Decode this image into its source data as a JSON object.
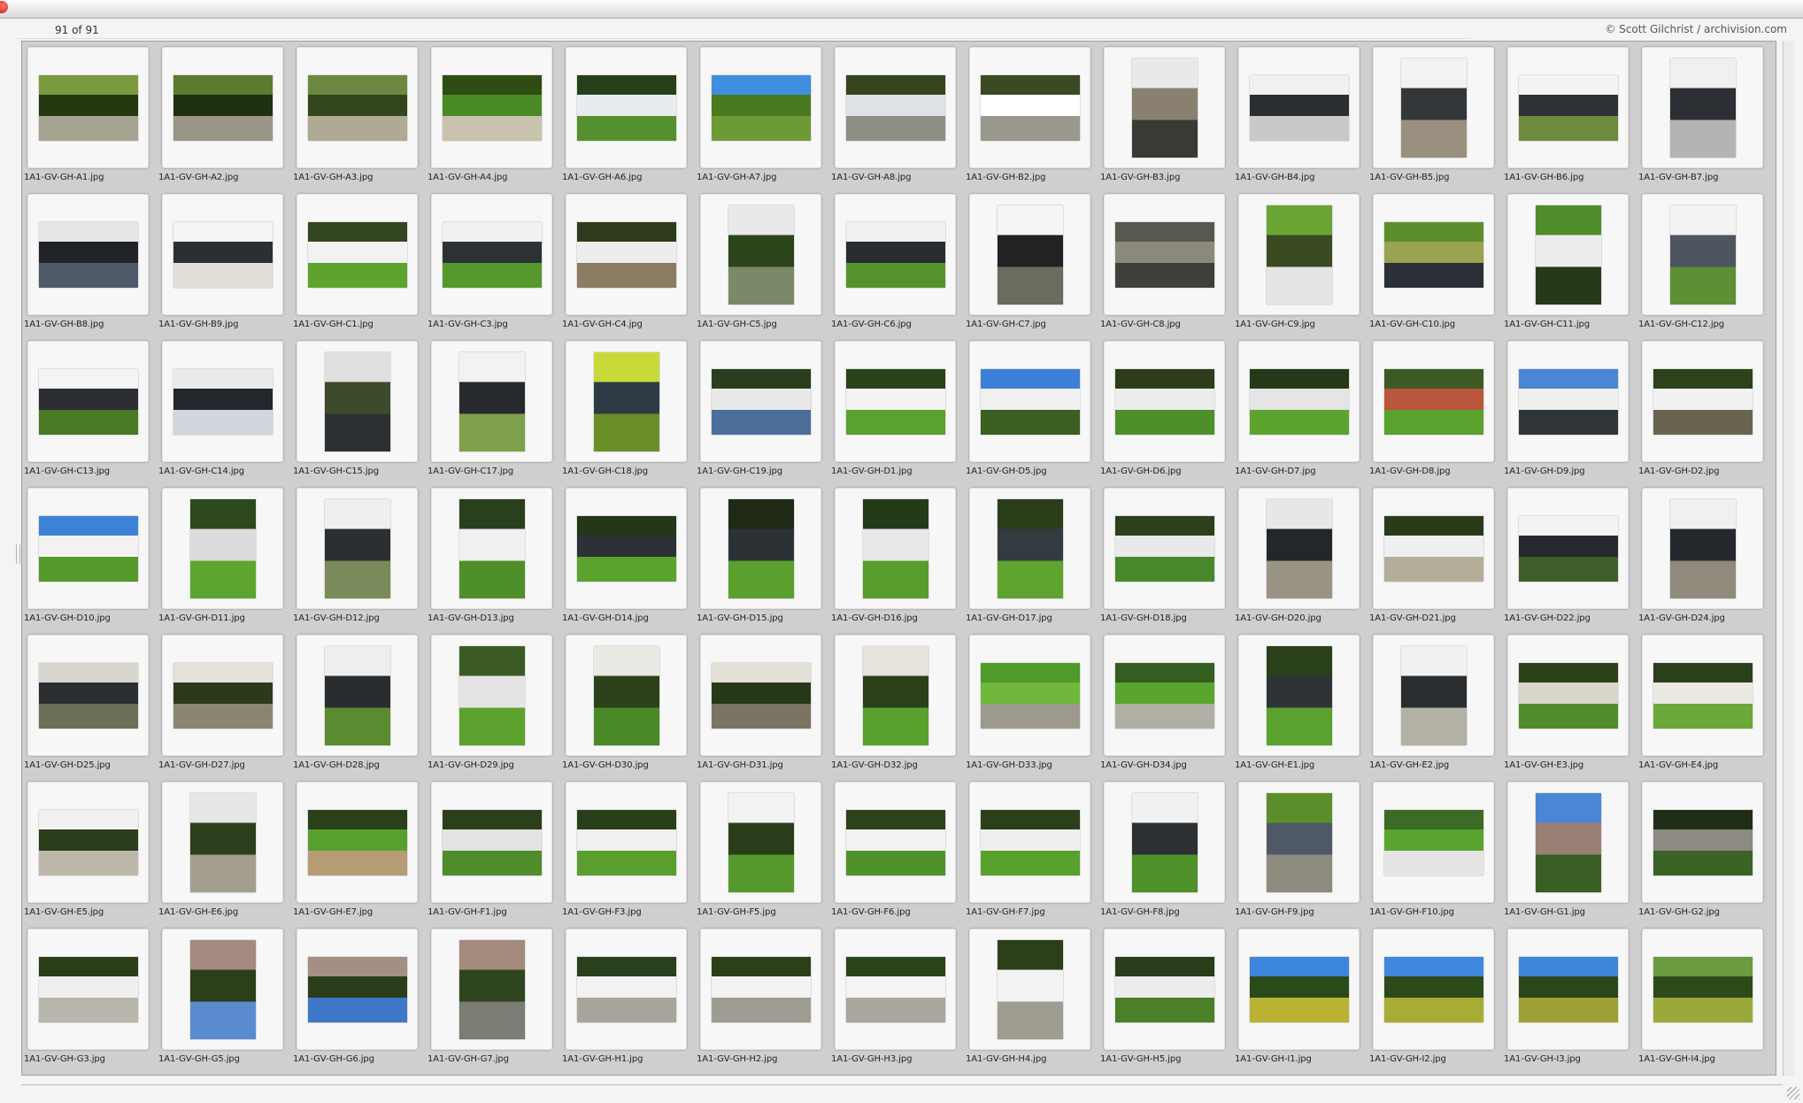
{
  "window": {
    "counter": "91 of 91",
    "credit": "© Scott Gilchrist / archivision.com"
  },
  "thumbnails": [
    {
      "name": "1A1-GV-GH-A1.jpg",
      "orientation": "landscape",
      "colors": [
        "#7a9a3e",
        "#24380f",
        "#a5a38f"
      ]
    },
    {
      "name": "1A1-GV-GH-A2.jpg",
      "orientation": "landscape",
      "colors": [
        "#5d7a2e",
        "#1f3010",
        "#9a9586"
      ]
    },
    {
      "name": "1A1-GV-GH-A3.jpg",
      "orientation": "landscape",
      "colors": [
        "#6b8740",
        "#33451b",
        "#b0a993"
      ]
    },
    {
      "name": "1A1-GV-GH-A4.jpg",
      "orientation": "landscape",
      "colors": [
        "#2f4d13",
        "#4a8a24",
        "#c9c2ad"
      ]
    },
    {
      "name": "1A1-GV-GH-A6.jpg",
      "orientation": "landscape",
      "colors": [
        "#27401b",
        "#e8ecee",
        "#55922f"
      ]
    },
    {
      "name": "1A1-GV-GH-A7.jpg",
      "orientation": "landscape",
      "colors": [
        "#3f8fe0",
        "#4a7a1f",
        "#6e9a35"
      ]
    },
    {
      "name": "1A1-GV-GH-A8.jpg",
      "orientation": "landscape",
      "colors": [
        "#35451f",
        "#dfe2e4",
        "#8f8e84"
      ]
    },
    {
      "name": "1A1-GV-GH-B2.jpg",
      "orientation": "landscape",
      "colors": [
        "#3a4a22",
        "#ffffff",
        "#9b988e"
      ]
    },
    {
      "name": "1A1-GV-GH-B3.jpg",
      "orientation": "portrait",
      "colors": [
        "#e9e9e9",
        "#8a8070",
        "#3a3a34"
      ]
    },
    {
      "name": "1A1-GV-GH-B4.jpg",
      "orientation": "landscape",
      "colors": [
        "#f0f0f0",
        "#2a2e33",
        "#c9c9c9"
      ]
    },
    {
      "name": "1A1-GV-GH-B5.jpg",
      "orientation": "portrait",
      "colors": [
        "#f2f2f2",
        "#33373a",
        "#9a9080"
      ]
    },
    {
      "name": "1A1-GV-GH-B6.jpg",
      "orientation": "landscape",
      "colors": [
        "#f3f3f3",
        "#2e3235",
        "#6c8b3c"
      ]
    },
    {
      "name": "1A1-GV-GH-B7.jpg",
      "orientation": "portrait",
      "colors": [
        "#f0f0f0",
        "#2c3034",
        "#b4b4b4"
      ]
    },
    {
      "name": "1A1-GV-GH-B8.jpg",
      "orientation": "landscape",
      "colors": [
        "#e6e6e6",
        "#202327",
        "#4d5a6a"
      ]
    },
    {
      "name": "1A1-GV-GH-B9.jpg",
      "orientation": "landscape",
      "colors": [
        "#f4f4f4",
        "#2b2f33",
        "#e0ded6"
      ]
    },
    {
      "name": "1A1-GV-GH-C1.jpg",
      "orientation": "landscape",
      "colors": [
        "#31461f",
        "#f2f2f2",
        "#5ea32c"
      ]
    },
    {
      "name": "1A1-GV-GH-C3.jpg",
      "orientation": "landscape",
      "colors": [
        "#f1f1f1",
        "#2d3236",
        "#55982b"
      ]
    },
    {
      "name": "1A1-GV-GH-C4.jpg",
      "orientation": "landscape",
      "colors": [
        "#2e3b1c",
        "#ededed",
        "#8b7c62"
      ]
    },
    {
      "name": "1A1-GV-GH-C5.jpg",
      "orientation": "portrait",
      "colors": [
        "#e9e9e9",
        "#2c4419",
        "#7a8a68"
      ]
    },
    {
      "name": "1A1-GV-GH-C6.jpg",
      "orientation": "landscape",
      "colors": [
        "#f0f0f0",
        "#2a2d30",
        "#56932c"
      ]
    },
    {
      "name": "1A1-GV-GH-C7.jpg",
      "orientation": "portrait",
      "colors": [
        "#f5f5f5",
        "#202224",
        "#6b6b5f"
      ]
    },
    {
      "name": "1A1-GV-GH-C8.jpg",
      "orientation": "landscape",
      "colors": [
        "#57584f",
        "#8b8a7a",
        "#3f403a"
      ]
    },
    {
      "name": "1A1-GV-GH-C9.jpg",
      "orientation": "portrait",
      "colors": [
        "#6aa533",
        "#3a4b22",
        "#e4e4e4"
      ]
    },
    {
      "name": "1A1-GV-GH-C10.jpg",
      "orientation": "landscape",
      "colors": [
        "#5c8f2b",
        "#9aa352",
        "#2a3035"
      ]
    },
    {
      "name": "1A1-GV-GH-C11.jpg",
      "orientation": "portrait",
      "colors": [
        "#4f8d2a",
        "#ececec",
        "#263a18"
      ]
    },
    {
      "name": "1A1-GV-GH-C12.jpg",
      "orientation": "portrait",
      "colors": [
        "#f3f3f3",
        "#4c5560",
        "#5f8f34"
      ]
    },
    {
      "name": "1A1-GV-GH-C13.jpg",
      "orientation": "landscape",
      "colors": [
        "#f4f4f4",
        "#2b2f33",
        "#4b7a26"
      ]
    },
    {
      "name": "1A1-GV-GH-C14.jpg",
      "orientation": "landscape",
      "colors": [
        "#eaeaea",
        "#23272b",
        "#cfd6dc"
      ]
    },
    {
      "name": "1A1-GV-GH-C15.jpg",
      "orientation": "portrait",
      "colors": [
        "#e0e0e0",
        "#3d4a2c",
        "#2d3033"
      ]
    },
    {
      "name": "1A1-GV-GH-C17.jpg",
      "orientation": "portrait",
      "colors": [
        "#f2f2f2",
        "#272a2d",
        "#7fa04a"
      ]
    },
    {
      "name": "1A1-GV-GH-C18.jpg",
      "orientation": "portrait",
      "colors": [
        "#c8d93a",
        "#2e3b45",
        "#6c8e28"
      ]
    },
    {
      "name": "1A1-GV-GH-C19.jpg",
      "orientation": "landscape",
      "colors": [
        "#2a3e1e",
        "#e9e9e9",
        "#4c6e9a"
      ]
    },
    {
      "name": "1A1-GV-GH-D1.jpg",
      "orientation": "landscape",
      "colors": [
        "#2a421a",
        "#f2f2f2",
        "#5aa22d"
      ]
    },
    {
      "name": "1A1-GV-GH-D5.jpg",
      "orientation": "landscape",
      "colors": [
        "#3d7fd8",
        "#f0f0f0",
        "#3b5f22"
      ]
    },
    {
      "name": "1A1-GV-GH-D6.jpg",
      "orientation": "landscape",
      "colors": [
        "#2c3d1b",
        "#ececec",
        "#4d8f28"
      ]
    },
    {
      "name": "1A1-GV-GH-D7.jpg",
      "orientation": "landscape",
      "colors": [
        "#253818",
        "#e5e5e5",
        "#5da42f"
      ]
    },
    {
      "name": "1A1-GV-GH-D8.jpg",
      "orientation": "landscape",
      "colors": [
        "#3c5a24",
        "#b8573c",
        "#5aa12e"
      ]
    },
    {
      "name": "1A1-GV-GH-D9.jpg",
      "orientation": "landscape",
      "colors": [
        "#4a86d6",
        "#efefef",
        "#2f3438"
      ]
    },
    {
      "name": "1A1-GV-GH-D2.jpg",
      "orientation": "landscape",
      "colors": [
        "#2c421b",
        "#f1f1f1",
        "#6a6350"
      ]
    },
    {
      "name": "1A1-GV-GH-D10.jpg",
      "orientation": "landscape",
      "colors": [
        "#3e82d8",
        "#f2f2f2",
        "#55982c"
      ]
    },
    {
      "name": "1A1-GV-GH-D11.jpg",
      "orientation": "portrait",
      "colors": [
        "#2e4a1c",
        "#dcdcdc",
        "#5ea52f"
      ]
    },
    {
      "name": "1A1-GV-GH-D12.jpg",
      "orientation": "portrait",
      "colors": [
        "#efefef",
        "#2c2f31",
        "#7a8a5a"
      ]
    },
    {
      "name": "1A1-GV-GH-D13.jpg",
      "orientation": "portrait",
      "colors": [
        "#2a3f1b",
        "#f0f0f0",
        "#4f8f29"
      ]
    },
    {
      "name": "1A1-GV-GH-D14.jpg",
      "orientation": "landscape",
      "colors": [
        "#243719",
        "#2c3137",
        "#5aa42e"
      ]
    },
    {
      "name": "1A1-GV-GH-D15.jpg",
      "orientation": "portrait",
      "colors": [
        "#1f2b16",
        "#2c3136",
        "#5b9f2c"
      ]
    },
    {
      "name": "1A1-GV-GH-D16.jpg",
      "orientation": "portrait",
      "colors": [
        "#253b18",
        "#e8e8e8",
        "#589c2c"
      ]
    },
    {
      "name": "1A1-GV-GH-D17.jpg",
      "orientation": "portrait",
      "colors": [
        "#2a3e1a",
        "#333a40",
        "#60a430"
      ]
    },
    {
      "name": "1A1-GV-GH-D18.jpg",
      "orientation": "landscape",
      "colors": [
        "#2b401b",
        "#e9e9e9",
        "#49882a"
      ]
    },
    {
      "name": "1A1-GV-GH-D20.jpg",
      "orientation": "portrait",
      "colors": [
        "#e7e7e7",
        "#23272a",
        "#9a9484"
      ]
    },
    {
      "name": "1A1-GV-GH-D21.jpg",
      "orientation": "landscape",
      "colors": [
        "#2a3b1a",
        "#efefef",
        "#b3ad9a"
      ]
    },
    {
      "name": "1A1-GV-GH-D22.jpg",
      "orientation": "landscape",
      "colors": [
        "#f3f3f3",
        "#262a2e",
        "#3f5f2a"
      ]
    },
    {
      "name": "1A1-GV-GH-D24.jpg",
      "orientation": "portrait",
      "colors": [
        "#f0f0f0",
        "#24282c",
        "#8f8a7c"
      ]
    },
    {
      "name": "1A1-GV-GH-D25.jpg",
      "orientation": "landscape",
      "colors": [
        "#d8d6cf",
        "#2c2f31",
        "#6b6f55"
      ]
    },
    {
      "name": "1A1-GV-GH-D27.jpg",
      "orientation": "landscape",
      "colors": [
        "#e4e1da",
        "#2c3a1c",
        "#8c8670"
      ]
    },
    {
      "name": "1A1-GV-GH-D28.jpg",
      "orientation": "portrait",
      "colors": [
        "#eeeeee",
        "#2a2d30",
        "#5b8c31"
      ]
    },
    {
      "name": "1A1-GV-GH-D29.jpg",
      "orientation": "portrait",
      "colors": [
        "#3a5a24",
        "#e4e4e4",
        "#5da12e"
      ]
    },
    {
      "name": "1A1-GV-GH-D30.jpg",
      "orientation": "portrait",
      "colors": [
        "#ebe9e3",
        "#2c4119",
        "#4a8927"
      ]
    },
    {
      "name": "1A1-GV-GH-D31.jpg",
      "orientation": "landscape",
      "colors": [
        "#e3e0d8",
        "#263a18",
        "#7b7462"
      ]
    },
    {
      "name": "1A1-GV-GH-D32.jpg",
      "orientation": "portrait",
      "colors": [
        "#e6e3dc",
        "#2b4019",
        "#5aa02d"
      ]
    },
    {
      "name": "1A1-GV-GH-D33.jpg",
      "orientation": "landscape",
      "colors": [
        "#4e9a2a",
        "#6fb839",
        "#9d998d"
      ]
    },
    {
      "name": "1A1-GV-GH-D34.jpg",
      "orientation": "landscape",
      "colors": [
        "#345e1f",
        "#5aa52e",
        "#b1aea3"
      ]
    },
    {
      "name": "1A1-GV-GH-E1.jpg",
      "orientation": "portrait",
      "colors": [
        "#29401a",
        "#2e3337",
        "#5ba12d"
      ]
    },
    {
      "name": "1A1-GV-GH-E2.jpg",
      "orientation": "portrait",
      "colors": [
        "#f1f1f1",
        "#2a2e31",
        "#b3b0a4"
      ]
    },
    {
      "name": "1A1-GV-GH-E3.jpg",
      "orientation": "landscape",
      "colors": [
        "#2b4219",
        "#d8d5cb",
        "#4f8d2a"
      ]
    },
    {
      "name": "1A1-GV-GH-E4.jpg",
      "orientation": "landscape",
      "colors": [
        "#2a3f1b",
        "#ece9e2",
        "#6aa83a"
      ]
    },
    {
      "name": "1A1-GV-GH-E5.jpg",
      "orientation": "landscape",
      "colors": [
        "#f0f0f0",
        "#2a3d1b",
        "#bdb8aa"
      ]
    },
    {
      "name": "1A1-GV-GH-E6.jpg",
      "orientation": "portrait",
      "colors": [
        "#e7e7e7",
        "#2c3f1c",
        "#a39e8f"
      ]
    },
    {
      "name": "1A1-GV-GH-E7.jpg",
      "orientation": "landscape",
      "colors": [
        "#2a401a",
        "#58a02e",
        "#b79b75"
      ]
    },
    {
      "name": "1A1-GV-GH-F1.jpg",
      "orientation": "landscape",
      "colors": [
        "#2b3f1b",
        "#e3e3e3",
        "#4e8d29"
      ]
    },
    {
      "name": "1A1-GV-GH-F3.jpg",
      "orientation": "landscape",
      "colors": [
        "#284019",
        "#f0f0f0",
        "#5a9f2d"
      ]
    },
    {
      "name": "1A1-GV-GH-F5.jpg",
      "orientation": "portrait",
      "colors": [
        "#f2f2f2",
        "#2a3d1b",
        "#55992c"
      ]
    },
    {
      "name": "1A1-GV-GH-F6.jpg",
      "orientation": "landscape",
      "colors": [
        "#2d421c",
        "#f3f3f3",
        "#4f9229"
      ]
    },
    {
      "name": "1A1-GV-GH-F7.jpg",
      "orientation": "landscape",
      "colors": [
        "#2b3f1a",
        "#efefef",
        "#56a22c"
      ]
    },
    {
      "name": "1A1-GV-GH-F8.jpg",
      "orientation": "portrait",
      "colors": [
        "#f1f1f1",
        "#2c3033",
        "#4e9229"
      ]
    },
    {
      "name": "1A1-GV-GH-F9.jpg",
      "orientation": "portrait",
      "colors": [
        "#5c8f2b",
        "#4f5966",
        "#8d8a7e"
      ]
    },
    {
      "name": "1A1-GV-GH-F10.jpg",
      "orientation": "landscape",
      "colors": [
        "#3b6b24",
        "#5aa42f",
        "#e4e4e4"
      ]
    },
    {
      "name": "1A1-GV-GH-G1.jpg",
      "orientation": "portrait",
      "colors": [
        "#4a86d4",
        "#9a7f74",
        "#3a5f25"
      ]
    },
    {
      "name": "1A1-GV-GH-G2.jpg",
      "orientation": "landscape",
      "colors": [
        "#1f2d17",
        "#8c8a82",
        "#3b6326"
      ]
    },
    {
      "name": "1A1-GV-GH-G3.jpg",
      "orientation": "landscape",
      "colors": [
        "#2a3e1a",
        "#efefef",
        "#b8b5aa"
      ]
    },
    {
      "name": "1A1-GV-GH-G5.jpg",
      "orientation": "portrait",
      "colors": [
        "#a48a7e",
        "#2b3f1b",
        "#5b8bcf"
      ]
    },
    {
      "name": "1A1-GV-GH-G6.jpg",
      "orientation": "landscape",
      "colors": [
        "#a48f82",
        "#2c3d1c",
        "#3e78c8"
      ]
    },
    {
      "name": "1A1-GV-GH-G7.jpg",
      "orientation": "portrait",
      "colors": [
        "#a48a7c",
        "#2f4520",
        "#7c7b74"
      ]
    },
    {
      "name": "1A1-GV-GH-H1.jpg",
      "orientation": "landscape",
      "colors": [
        "#2a3f1b",
        "#f2f2f2",
        "#a7a499"
      ]
    },
    {
      "name": "1A1-GV-GH-H2.jpg",
      "orientation": "landscape",
      "colors": [
        "#2b4019",
        "#f3f3f3",
        "#9e9b90"
      ]
    },
    {
      "name": "1A1-GV-GH-H3.jpg",
      "orientation": "landscape",
      "colors": [
        "#2c4219",
        "#f4f4f4",
        "#aaa79c"
      ]
    },
    {
      "name": "1A1-GV-GH-H4.jpg",
      "orientation": "portrait",
      "colors": [
        "#2b3f1b",
        "#f2f2f2",
        "#9f9c91"
      ]
    },
    {
      "name": "1A1-GV-GH-H5.jpg",
      "orientation": "landscape",
      "colors": [
        "#2a3d1a",
        "#ececec",
        "#4b7f28"
      ]
    },
    {
      "name": "1A1-GV-GH-I1.jpg",
      "orientation": "landscape",
      "colors": [
        "#3c86dc",
        "#2a4a1a",
        "#b9b233"
      ]
    },
    {
      "name": "1A1-GV-GH-I2.jpg",
      "orientation": "landscape",
      "colors": [
        "#3f88dd",
        "#2c4a1a",
        "#a8ac35"
      ]
    },
    {
      "name": "1A1-GV-GH-I3.jpg",
      "orientation": "landscape",
      "colors": [
        "#3e86da",
        "#2b4719",
        "#9e9f34"
      ]
    },
    {
      "name": "1A1-GV-GH-I4.jpg",
      "orientation": "landscape",
      "colors": [
        "#6c9a40",
        "#2d4a1b",
        "#9aa93a"
      ]
    }
  ]
}
